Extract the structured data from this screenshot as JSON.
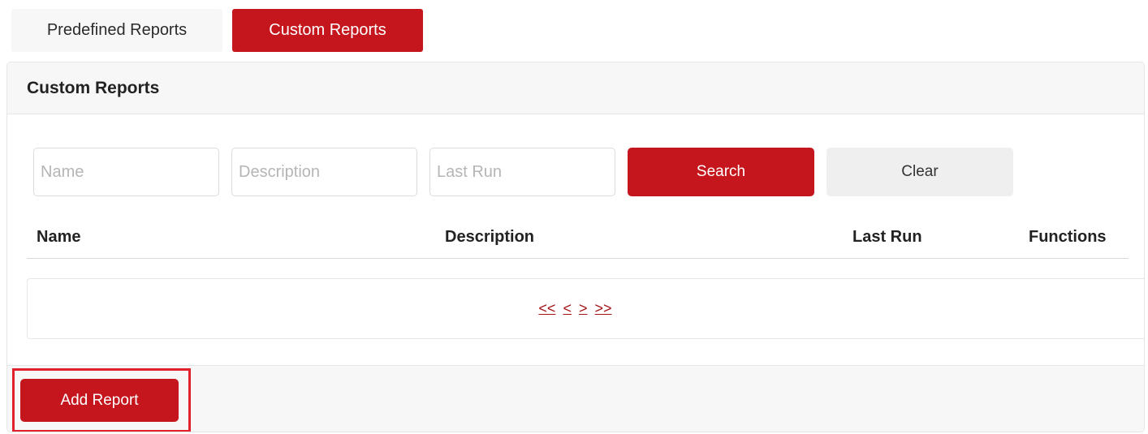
{
  "tabs": [
    {
      "label": "Predefined Reports",
      "active": false
    },
    {
      "label": "Custom Reports",
      "active": true
    }
  ],
  "card": {
    "title": "Custom Reports"
  },
  "filters": {
    "name_placeholder": "Name",
    "description_placeholder": "Description",
    "last_run_placeholder": "Last Run",
    "search_label": "Search",
    "clear_label": "Clear"
  },
  "table": {
    "columns": [
      "Name",
      "Description",
      "Last Run",
      "Functions"
    ],
    "rows": []
  },
  "pager": {
    "first": "<<",
    "prev": "<",
    "next": ">",
    "last": ">>"
  },
  "footer": {
    "add_label": "Add Report"
  },
  "colors": {
    "accent": "#c4161c",
    "highlight": "#e0202a",
    "panel_bg": "#f7f7f7"
  }
}
